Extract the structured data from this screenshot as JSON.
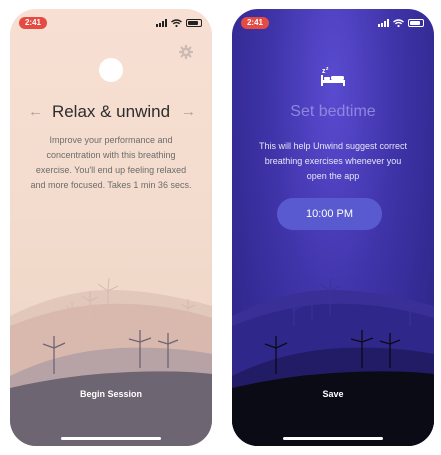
{
  "left_screen": {
    "status_time": "2:41",
    "title": "Relax & unwind",
    "prev_arrow": "←",
    "next_arrow": "→",
    "description": "Improve your performance and concentration with this breathing exercise. You'll end up feeling relaxed and more focused. Takes 1 min 36 secs.",
    "button_label": "Begin Session",
    "icons": [
      "settings-gear-icon",
      "arrow-left-icon",
      "arrow-right-icon"
    ],
    "colors": {
      "background": "#f3dccd",
      "hills_back": "#d9b9ad",
      "hills_front": "#6e6573"
    }
  },
  "right_screen": {
    "status_time": "2:41",
    "title": "Set bedtime",
    "description": "This will help Unwind suggest correct breathing exercises whenever you open the app",
    "time_value": "10:00 PM",
    "button_label": "Save",
    "icons": [
      "bed-sleep-icon"
    ],
    "colors": {
      "background": "#3f33a8",
      "pill": "#5a5ad0",
      "hills_back": "#2d2578",
      "hills_front": "#0b0b16"
    }
  }
}
